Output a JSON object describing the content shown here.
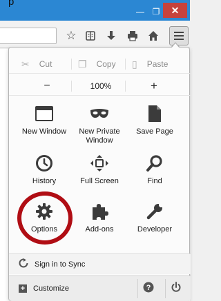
{
  "window": {
    "title_fragment": "p",
    "minimize_glyph": "—",
    "maximize_glyph": "❐",
    "close_glyph": "✕",
    "titlebar_color": "#2b87d3",
    "close_color": "#c6423c"
  },
  "toolbar": {
    "icons": [
      "bookmark-star-icon",
      "reading-list-icon",
      "downloads-icon",
      "print-icon",
      "home-icon",
      "menu-icon"
    ]
  },
  "menu": {
    "edit": {
      "cut": "Cut",
      "copy": "Copy",
      "paste": "Paste"
    },
    "zoom": {
      "out": "−",
      "value": "100%",
      "in": "+"
    },
    "items": [
      {
        "label": "New Window",
        "icon": "new-window-icon"
      },
      {
        "label": "New Private Window",
        "icon": "private-mask-icon"
      },
      {
        "label": "Save Page",
        "icon": "save-page-icon"
      },
      {
        "label": "History",
        "icon": "history-clock-icon"
      },
      {
        "label": "Full Screen",
        "icon": "fullscreen-icon"
      },
      {
        "label": "Find",
        "icon": "find-magnifier-icon"
      },
      {
        "label": "Options",
        "icon": "options-gear-icon"
      },
      {
        "label": "Add-ons",
        "icon": "addons-puzzle-icon"
      },
      {
        "label": "Developer",
        "icon": "developer-wrench-icon"
      }
    ],
    "sync_label": "Sign in to Sync",
    "customize_label": "Customize",
    "customize_glyph": "+",
    "help_icon": "help-icon",
    "quit_icon": "power-icon",
    "highlight_color": "#b00d14"
  }
}
